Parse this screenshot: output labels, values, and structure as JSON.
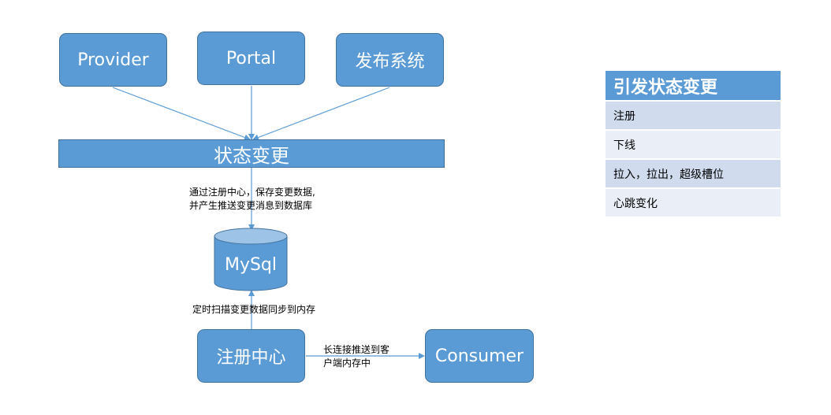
{
  "nodes": {
    "provider": "Provider",
    "portal": "Portal",
    "release_system": "发布系统",
    "state_change": "状态变更",
    "mysql": "MySql",
    "registry": "注册中心",
    "consumer": "Consumer"
  },
  "edge_labels": {
    "save_to_db": "通过注册中心，保存变更数据,\n并产生推送变更消息到数据库",
    "sync_to_memory": "定时扫描变更数据同步到内存",
    "push_to_client": "长连接推送到客\n户端内存中"
  },
  "trigger_table": {
    "header": "引发状态变更",
    "rows": [
      "注册",
      "下线",
      "拉入，拉出，超级槽位",
      "心跳变化"
    ]
  },
  "colors": {
    "node_fill": "#5b9bd5",
    "node_border": "#41719c",
    "table_row_odd": "#d0dbee",
    "table_row_even": "#e9eef7"
  }
}
